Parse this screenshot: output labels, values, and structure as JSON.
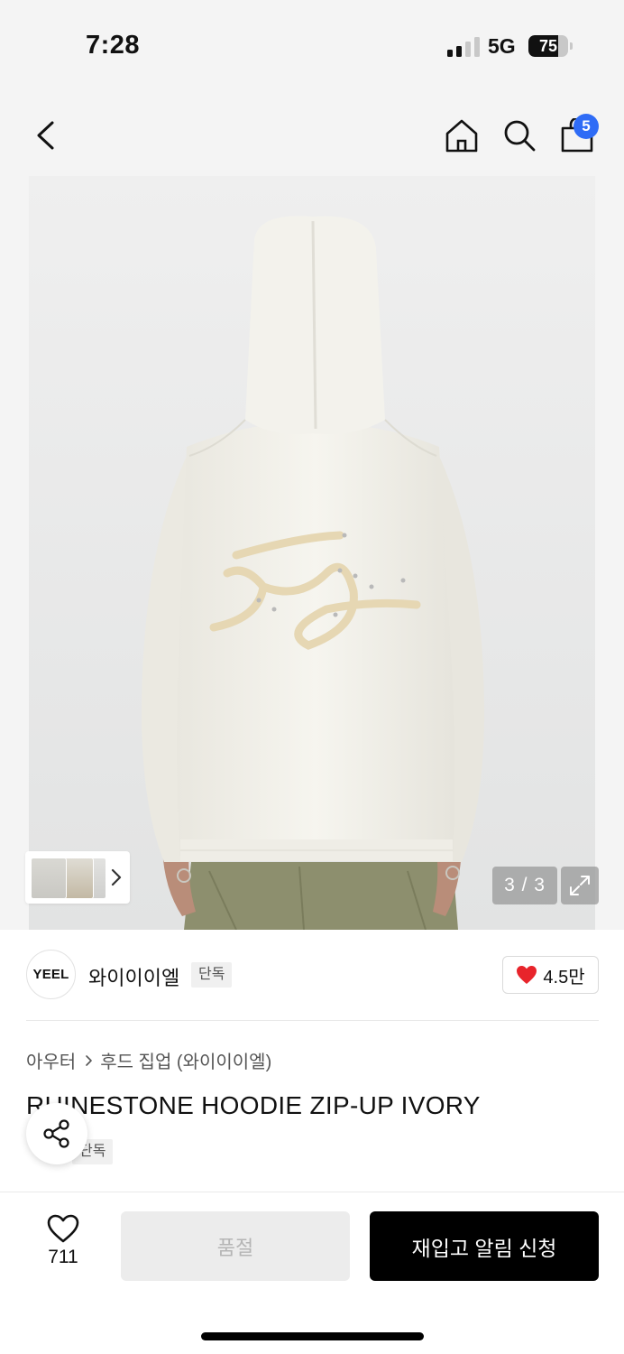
{
  "status_bar": {
    "time": "7:28",
    "network": "5G",
    "battery": "75",
    "battery_level": 0.75
  },
  "nav": {
    "back_icon": "chevron-left-icon",
    "home_icon": "home-icon",
    "search_icon": "search-icon",
    "cart_icon": "shopping-bag-icon",
    "cart_badge": "5",
    "badge_color": "#2f6cf6"
  },
  "gallery": {
    "counter": "3 / 3",
    "expand_icon": "expand-icon",
    "thumbnail_count": 3
  },
  "brand": {
    "logo_text": "YEEL",
    "name": "와이이이엘",
    "tag": "단독",
    "likes": "4.5만",
    "heart_color": "#e8242b"
  },
  "product": {
    "breadcrumb": [
      "아우터",
      "후드 집업 (와이이이엘)"
    ],
    "title": "RHINESTONE HOODIE ZIP-UP IVORY",
    "tag": "단독",
    "share_icon": "share-icon"
  },
  "bottom_bar": {
    "wish_icon": "heart-outline-icon",
    "wish_count": "711",
    "soldout_label": "품절",
    "restock_label": "재입고 알림 신청"
  }
}
